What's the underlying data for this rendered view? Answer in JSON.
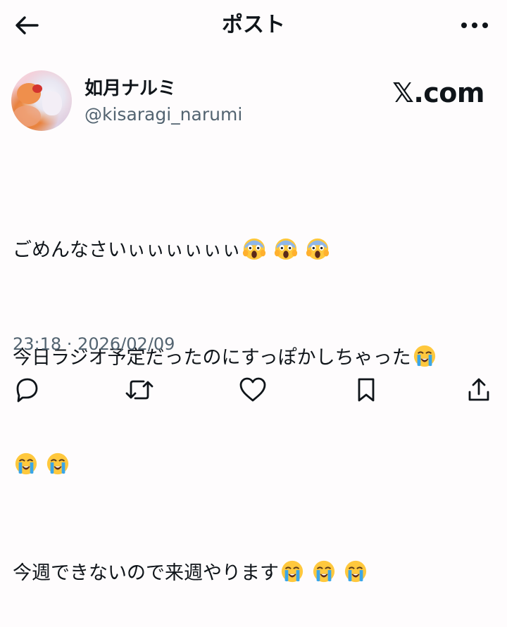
{
  "header": {
    "title": "ポスト",
    "back_icon": "arrow-left-icon",
    "more_icon": "more-horizontal-icon"
  },
  "author": {
    "display_name": "如月ナルミ",
    "handle": "@kisaragi_narumi"
  },
  "watermark": "𝕏.com",
  "tweet": {
    "lines": [
      {
        "text": "ごめんなさいぃぃぃぃぃぃ",
        "emojis": [
          "scream-emoji",
          "scream-emoji",
          "scream-emoji"
        ]
      },
      {
        "text": "今日ラジオ予定だったのにすっぽかしちゃった",
        "emojis": [
          "loudly-crying-emoji"
        ]
      },
      {
        "text": "",
        "emojis": [
          "loudly-crying-emoji",
          "loudly-crying-emoji"
        ]
      },
      {
        "text": "今週できないので来週やります",
        "emojis": [
          "loudly-crying-emoji",
          "loudly-crying-emoji",
          "loudly-crying-emoji"
        ]
      }
    ],
    "timestamp": "23:18 · 2026/02/09"
  },
  "actions": [
    {
      "name": "reply",
      "icon": "reply-icon"
    },
    {
      "name": "repost",
      "icon": "repost-icon"
    },
    {
      "name": "like",
      "icon": "heart-icon"
    },
    {
      "name": "bookmark",
      "icon": "bookmark-icon"
    },
    {
      "name": "share",
      "icon": "share-icon"
    }
  ],
  "colors": {
    "text": "#0f1419",
    "secondary_text": "#536471",
    "background": "#fefcfd",
    "emoji_yellow": "#ffc83d",
    "emoji_tears": "#3aa6e8"
  }
}
